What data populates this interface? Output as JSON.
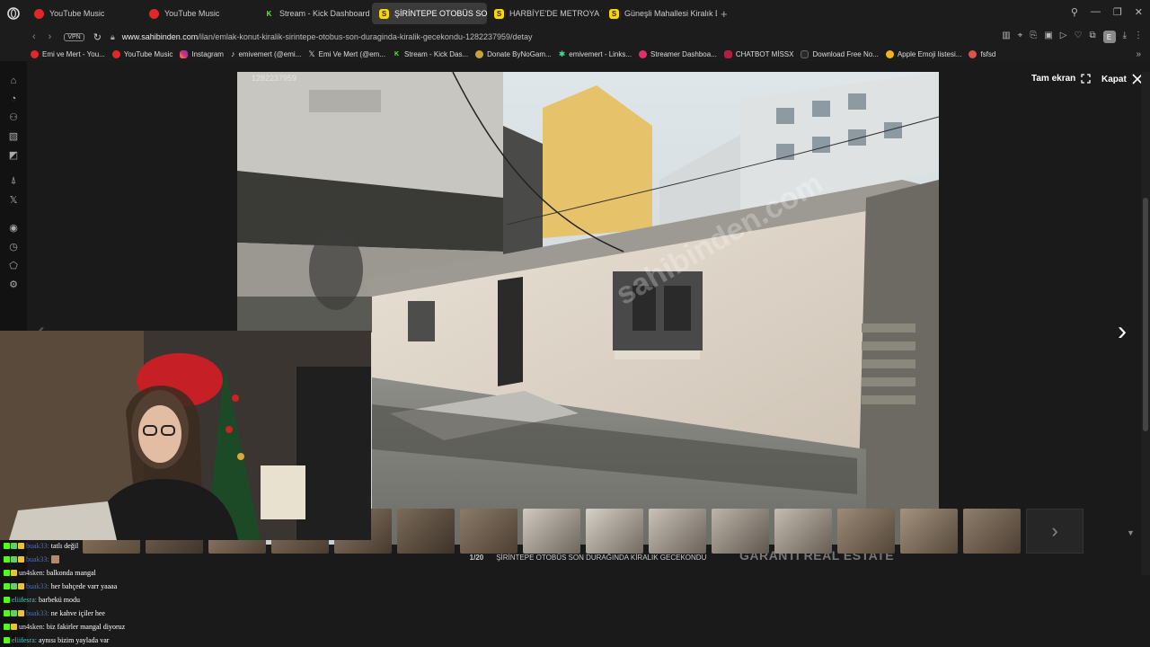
{
  "tabs": [
    {
      "label": "YouTube Music",
      "icon": "youtube-music-icon"
    },
    {
      "label": "YouTube Music",
      "icon": "youtube-music-icon"
    },
    {
      "label": "Stream - Kick Dashboard",
      "icon": "kick-icon"
    },
    {
      "label": "ŞİRİNTEPE OTOBÜS SON",
      "icon": "sahibinden-icon"
    },
    {
      "label": "HARBİYE'DE METROYA 7",
      "icon": "sahibinden-icon"
    },
    {
      "label": "Güneşli Mahallesi Kiralık D",
      "icon": "sahibinden-icon"
    }
  ],
  "address": {
    "vpn": "VPN",
    "host": "www.sahibinden.com",
    "path": "/ilan/emlak-konut-kiralik-sirintepe-otobus-son-duraginda-kiralik-gecekondu-1282237959/detay"
  },
  "bookmarks": [
    "Emi ve Mert - You...",
    "YouTube Music",
    "Instagram",
    "emivemert (@emi...",
    "Emi Ve Mert (@em...",
    "Stream - Kick Das...",
    "Donate ByNoGam...",
    "emivemert - Links...",
    "Streamer Dashboa...",
    "CHATBOT MİSSX",
    "Download Free No...",
    "Apple Emoji listesi...",
    "fsfsd"
  ],
  "ext_label": "E",
  "gallery": {
    "fullscreen_label": "Tam ekran",
    "close_label": "Kapat",
    "counter": "1/20",
    "caption": "ŞİRİNTEPE OTOBÜS SON DURAĞINDA KİRALIK GECEKONDU",
    "brand": "GARANTI REAL ESTATE",
    "overlay_brand": "GARANTİ",
    "watermark": "sahibinden.com",
    "photo_id": "1282237959",
    "thumb_count": 15
  },
  "chat": [
    {
      "user": "buak33:",
      "text": "tatlı değil",
      "color": "#3f6fd8"
    },
    {
      "user": "buak33:",
      "text": "",
      "color": "#3f6fd8"
    },
    {
      "user": "un4sken:",
      "text": "balkonda mangal",
      "color": "#e8e8e8"
    },
    {
      "user": "buak33:",
      "text": "her bahçede varr yaaaa",
      "color": "#3f6fd8"
    },
    {
      "user": "eliifesra:",
      "text": "barbekü modu",
      "color": "#4cc2c2"
    },
    {
      "user": "buak33:",
      "text": "ne kahve içiler hee",
      "color": "#3f6fd8"
    },
    {
      "user": "un4sken:",
      "text": "biz fakirler mangal diyoruz",
      "color": "#e8e8e8"
    },
    {
      "user": "eliifesra:",
      "text": "aynısı bizim yaylada var",
      "color": "#4cc2c2"
    }
  ]
}
